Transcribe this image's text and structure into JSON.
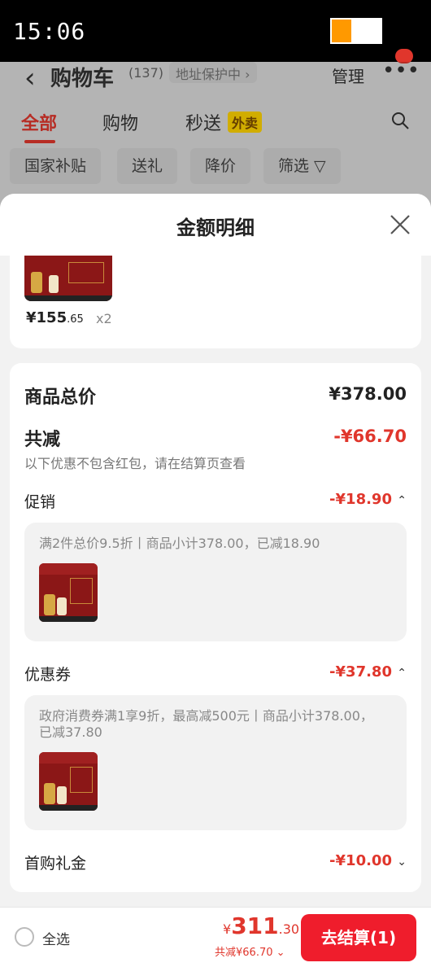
{
  "status": {
    "time": "15:06",
    "battery_percent": 40
  },
  "background": {
    "title": "购物车",
    "count": "(137)",
    "address": "地址保护中 ›",
    "manage": "管理",
    "tabs": [
      "全部",
      "购物",
      "秒送"
    ],
    "waimai_badge": "外卖",
    "filters": [
      "国家补贴",
      "送礼",
      "降价",
      "筛选 ▽"
    ]
  },
  "sheet": {
    "title": "金额明细",
    "top_item": {
      "price_int": "¥155",
      "price_dec": ".65",
      "qty": "x2"
    },
    "goods_total_label": "商品总价",
    "goods_total_value": "¥378.00",
    "total_reduction_label": "共减",
    "total_reduction_value": "-¥66.70",
    "note": "以下优惠不包含红包，请在结算页查看",
    "promo": {
      "label": "促销",
      "value": "-¥18.90",
      "chevron": "⌃",
      "detail": "满2件总价9.5折丨商品小计378.00，已减18.90"
    },
    "coupon": {
      "label": "优惠券",
      "value": "-¥37.80",
      "chevron": "⌃",
      "detail": "政府消费券满1享9折，最高减500元丨商品小计378.00，已减37.80"
    },
    "first_gift": {
      "label": "首购礼金",
      "value": "-¥10.00",
      "chevron": "⌄"
    }
  },
  "bottom": {
    "select_all": "全选",
    "total_currency": "¥",
    "total_int": "311",
    "total_dec": ".30",
    "saved": "共减¥66.70 ⌄",
    "checkout": "去结算(1)"
  },
  "colors": {
    "accent": "#e0362c",
    "checkout": "#ef1d2c",
    "product_bg": "#8b1717"
  }
}
